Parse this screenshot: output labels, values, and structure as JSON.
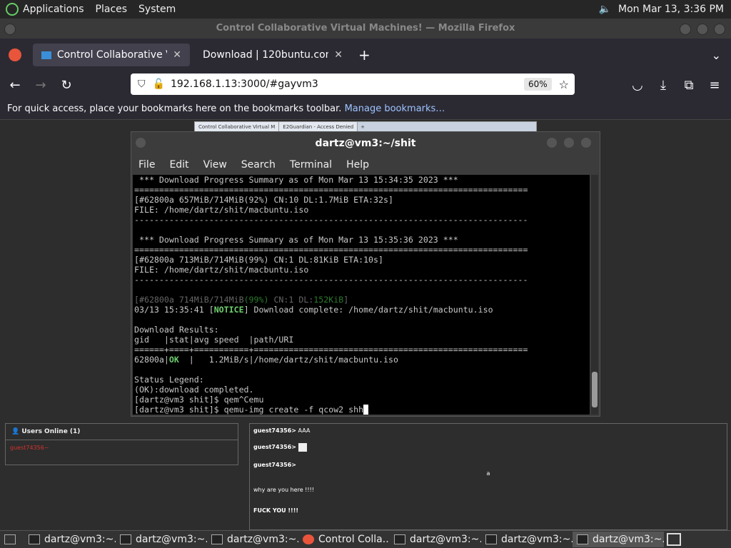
{
  "topbar": {
    "menus": [
      "Applications",
      "Places",
      "System"
    ],
    "clock": "Mon Mar 13,  3:36 PM"
  },
  "window": {
    "title": "Control Collaborative Virtual Machines! — Mozilla Firefox"
  },
  "tabs": [
    {
      "label": "Control Collaborative Virtual Machines!",
      "active": true
    },
    {
      "label": "Download | 120buntu.com",
      "active": false
    }
  ],
  "url": {
    "address": "192.168.1.13:3000/#gayvm3",
    "zoom": "60%"
  },
  "bookmarks": {
    "text": "For quick access, place your bookmarks here on the bookmarks toolbar.",
    "link": "Manage bookmarks…"
  },
  "vmstrip": {
    "tabs": [
      "Control Collaborative Virtual M",
      "E2Guardian - Access Denied"
    ]
  },
  "terminal": {
    "title": "dartz@vm3:~/shit",
    "menu": [
      "File",
      "Edit",
      "View",
      "Search",
      "Terminal",
      "Help"
    ],
    "lines": [
      " *** Download Progress Summary as of Mon Mar 13 15:34:35 2023 ***",
      "===============================================================================",
      "[#62800a 657MiB/714MiB(92%) CN:10 DL:1.7MiB ETA:32s]",
      "FILE: /home/dartz/shit/macbuntu.iso",
      "-------------------------------------------------------------------------------",
      "",
      " *** Download Progress Summary as of Mon Mar 13 15:35:36 2023 ***",
      "===============================================================================",
      "[#62800a 713MiB/714MiB(99%) CN:1 DL:81KiB ETA:10s]",
      "FILE: /home/dartz/shit/macbuntu.iso",
      "-------------------------------------------------------------------------------",
      ""
    ],
    "progress_line": {
      "pre": "[#62800a 714MiB/714MiB",
      "pct": "(99%)",
      "mid": " CN:1 DL:",
      "speed": "152KiB",
      "end": "]"
    },
    "notice_line": {
      "pre": "03/13 15:35:41 [",
      "tag": "NOTICE",
      "post": "] Download complete: /home/dartz/shit/macbuntu.iso"
    },
    "lines2": [
      "",
      "Download Results:",
      "gid   |stat|avg speed  |path/URI",
      "======+====+===========+======================================================="
    ],
    "result_line": {
      "pre": "62800a|",
      "ok": "OK",
      "post": "  |   1.2MiB/s|/home/dartz/shit/macbuntu.iso"
    },
    "lines3": [
      "",
      "Status Legend:",
      "(OK):download completed.",
      "[dartz@vm3 shit]$ qem^Cemu"
    ],
    "prompt": "[dartz@vm3 shit]$ qemu-img create -f qcow2 shh"
  },
  "users": {
    "header": "Users Online (1)",
    "list": [
      "guest74356~"
    ]
  },
  "chat": [
    {
      "user": "guest74356>",
      "text": " AAA"
    },
    {
      "user": "guest74356>",
      "text": ""
    },
    {
      "user": "guest74356>",
      "text": ""
    },
    {
      "user": "",
      "text": "why are you here !!!!"
    },
    {
      "user": "",
      "text": "FUCK YOU !!!!"
    }
  ],
  "chat_a": "a",
  "taskbar": [
    "dartz@vm3:~...",
    "dartz@vm3:~...",
    "dartz@vm3:~...",
    "Control Colla...",
    "dartz@vm3:~...",
    "dartz@vm3:~...",
    "dartz@vm3:~..."
  ]
}
